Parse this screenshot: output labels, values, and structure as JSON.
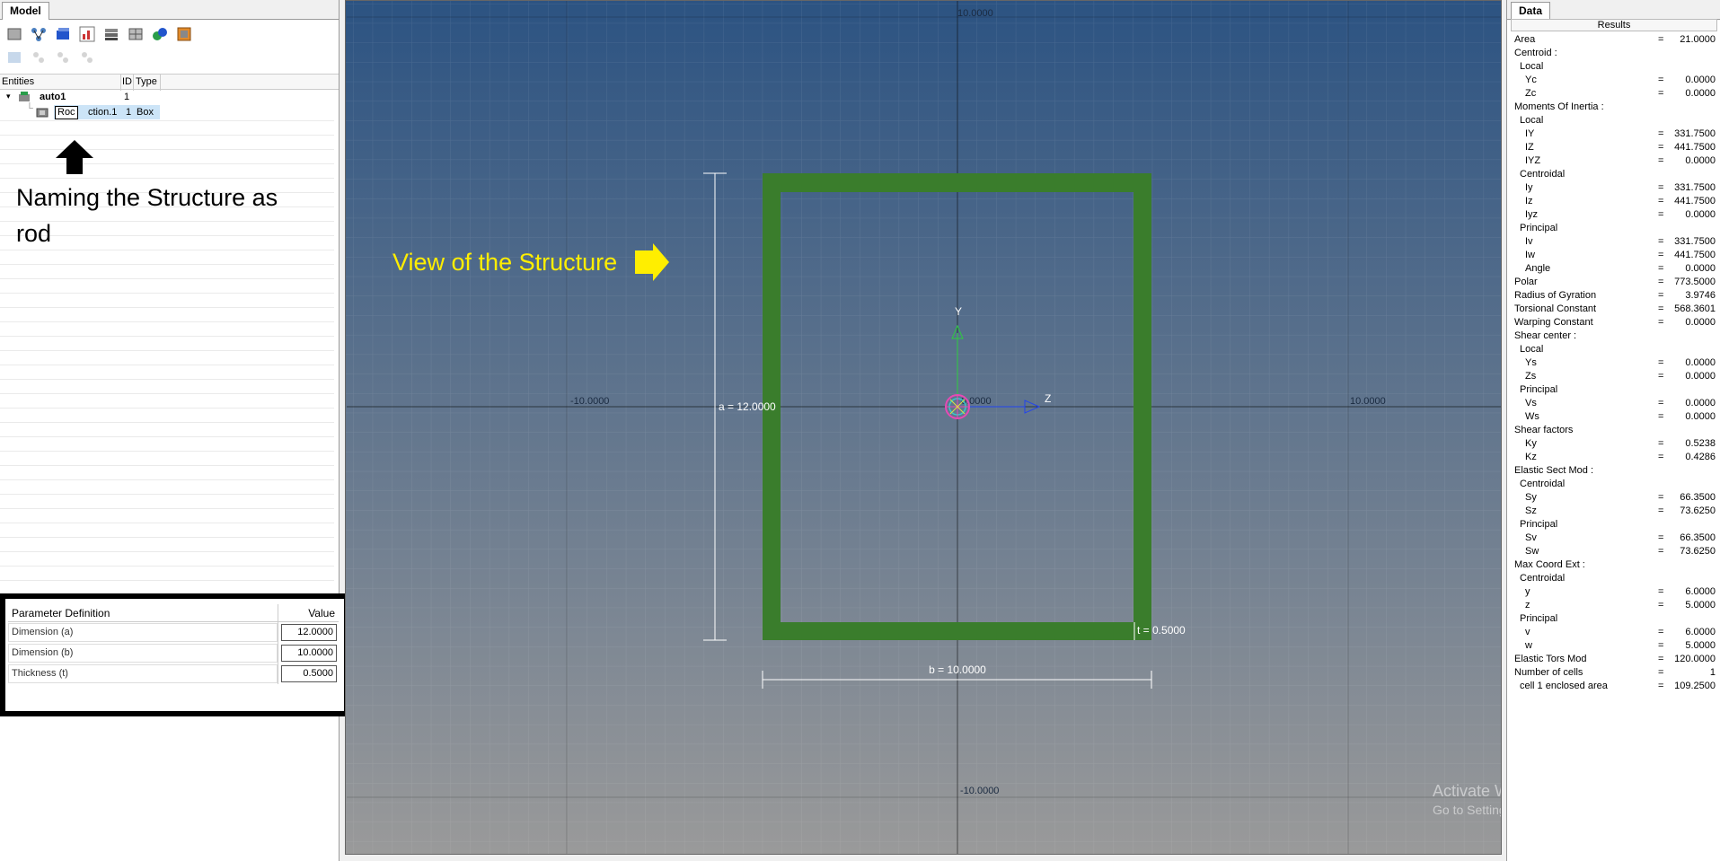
{
  "left_panel": {
    "tab_label": "Model",
    "entities_header": {
      "entities": "Entities",
      "id": "ID",
      "type": "Type"
    },
    "tree": [
      {
        "name": "auto1",
        "id": "1",
        "type": ""
      },
      {
        "name_editing": "Roc",
        "name_rest": "ction.1",
        "id": "1",
        "type": "Box"
      }
    ],
    "annotation": "Naming the Structure as rod",
    "parameters": {
      "header_label": "Parameter Definition",
      "header_value": "Value",
      "rows": [
        {
          "label": "Dimension (a)",
          "value": "12.0000"
        },
        {
          "label": "Dimension (b)",
          "value": "10.0000"
        },
        {
          "label": "Thickness (t)",
          "value": "0.5000"
        }
      ]
    }
  },
  "viewport": {
    "annotation": "View of the Structure",
    "dim_a": "a = 12.0000",
    "dim_b": "b = 10.0000",
    "dim_t": "t = 0.5000",
    "axis_y": "Y",
    "axis_z": "Z",
    "tick_top": "10.0000",
    "tick_left": "-10.0000",
    "tick_right": "10.0000",
    "tick_bottom": "-10.0000",
    "tick_center": "0.0000",
    "colors": {
      "section": "#3a7d2c",
      "annotation": "#ffee00",
      "bg_top": "#2c5382",
      "bg_bottom": "#9a9a9a"
    }
  },
  "right_panel": {
    "tab_label": "Data",
    "results_label": "Results",
    "rows": [
      {
        "label": "Area",
        "indent": 0,
        "value": "21.0000"
      },
      {
        "label": "Centroid :",
        "indent": 0,
        "value": ""
      },
      {
        "label": "Local",
        "indent": 1,
        "value": ""
      },
      {
        "label": "Yc",
        "indent": 2,
        "value": "0.0000"
      },
      {
        "label": "Zc",
        "indent": 2,
        "value": "0.0000"
      },
      {
        "label": "Moments Of Inertia :",
        "indent": 0,
        "value": ""
      },
      {
        "label": "Local",
        "indent": 1,
        "value": ""
      },
      {
        "label": "IY",
        "indent": 2,
        "value": "331.7500"
      },
      {
        "label": "IZ",
        "indent": 2,
        "value": "441.7500"
      },
      {
        "label": "IYZ",
        "indent": 2,
        "value": "0.0000"
      },
      {
        "label": "Centroidal",
        "indent": 1,
        "value": ""
      },
      {
        "label": "Iy",
        "indent": 2,
        "value": "331.7500"
      },
      {
        "label": "Iz",
        "indent": 2,
        "value": "441.7500"
      },
      {
        "label": "Iyz",
        "indent": 2,
        "value": "0.0000"
      },
      {
        "label": "Principal",
        "indent": 1,
        "value": ""
      },
      {
        "label": "Iv",
        "indent": 2,
        "value": "331.7500"
      },
      {
        "label": "Iw",
        "indent": 2,
        "value": "441.7500"
      },
      {
        "label": "Angle",
        "indent": 2,
        "value": "0.0000"
      },
      {
        "label": "Polar",
        "indent": 0,
        "value": "773.5000"
      },
      {
        "label": "Radius of Gyration",
        "indent": 0,
        "value": "3.9746"
      },
      {
        "label": "Torsional Constant",
        "indent": 0,
        "value": "568.3601"
      },
      {
        "label": "Warping Constant",
        "indent": 0,
        "value": "0.0000"
      },
      {
        "label": "Shear center :",
        "indent": 0,
        "value": ""
      },
      {
        "label": "Local",
        "indent": 1,
        "value": ""
      },
      {
        "label": "Ys",
        "indent": 2,
        "value": "0.0000"
      },
      {
        "label": "Zs",
        "indent": 2,
        "value": "0.0000"
      },
      {
        "label": "Principal",
        "indent": 1,
        "value": ""
      },
      {
        "label": "Vs",
        "indent": 2,
        "value": "0.0000"
      },
      {
        "label": "Ws",
        "indent": 2,
        "value": "0.0000"
      },
      {
        "label": "Shear factors",
        "indent": 0,
        "value": ""
      },
      {
        "label": "Ky",
        "indent": 2,
        "value": "0.5238"
      },
      {
        "label": "Kz",
        "indent": 2,
        "value": "0.4286"
      },
      {
        "label": "Elastic Sect Mod :",
        "indent": 0,
        "value": ""
      },
      {
        "label": "Centroidal",
        "indent": 1,
        "value": ""
      },
      {
        "label": "Sy",
        "indent": 2,
        "value": "66.3500"
      },
      {
        "label": "Sz",
        "indent": 2,
        "value": "73.6250"
      },
      {
        "label": "Principal",
        "indent": 1,
        "value": ""
      },
      {
        "label": "Sv",
        "indent": 2,
        "value": "66.3500"
      },
      {
        "label": "Sw",
        "indent": 2,
        "value": "73.6250"
      },
      {
        "label": "Max Coord Ext :",
        "indent": 0,
        "value": ""
      },
      {
        "label": "Centroidal",
        "indent": 1,
        "value": ""
      },
      {
        "label": "y",
        "indent": 2,
        "value": "6.0000"
      },
      {
        "label": "z",
        "indent": 2,
        "value": "5.0000"
      },
      {
        "label": "Principal",
        "indent": 1,
        "value": ""
      },
      {
        "label": "v",
        "indent": 2,
        "value": "6.0000"
      },
      {
        "label": "w",
        "indent": 2,
        "value": "5.0000"
      },
      {
        "label": "Elastic Tors Mod",
        "indent": 0,
        "value": "120.0000"
      },
      {
        "label": "Number of cells",
        "indent": 0,
        "value": "1"
      },
      {
        "label": "cell 1 enclosed area",
        "indent": 1,
        "value": "109.2500"
      }
    ]
  },
  "watermark": {
    "line1": "Activate Windows",
    "line2": "Go to Settings to activate Windows."
  }
}
